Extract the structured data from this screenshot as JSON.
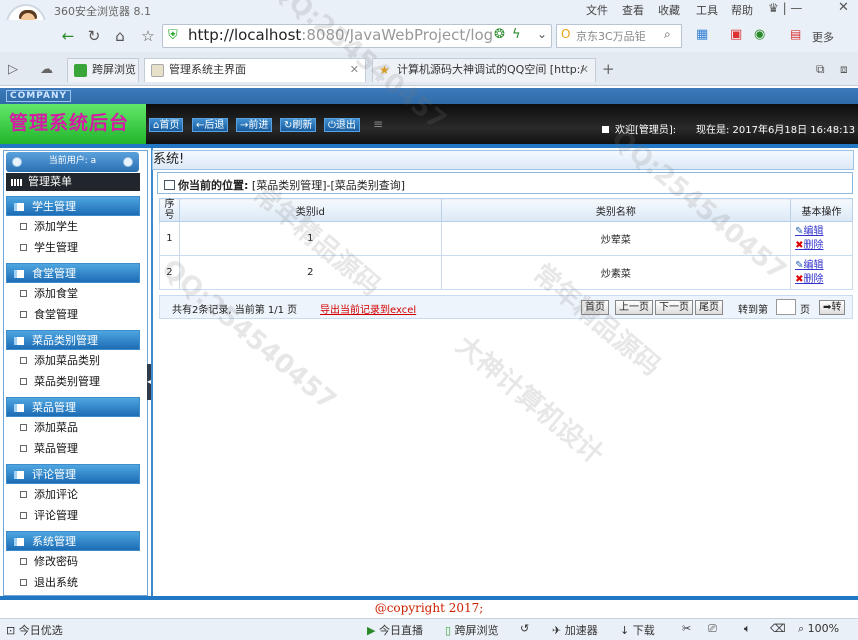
{
  "browser": {
    "name": "360安全浏览器 8.1",
    "menu": [
      "文件",
      "查看",
      "收藏",
      "工具",
      "帮助"
    ],
    "url_host": "http://localhost",
    "url_rest": ":8080/JavaWebProject/login/log",
    "search_placeholder": "京东3C万品钜",
    "more_label": "更多",
    "tabs": [
      {
        "label": "跨屏浏览"
      },
      {
        "label": "管理系统主界面"
      },
      {
        "label": "计算机源码大神调试的QQ空间 [http:/"
      }
    ],
    "status": {
      "left": "今日优选",
      "live": "今日直播",
      "cross": "跨屏浏览",
      "accel": "加速器",
      "download": "下载",
      "zoom": "100%"
    }
  },
  "app": {
    "company": "COMPANY",
    "logo": "管理系统后台",
    "toolbar": {
      "home": "首页",
      "back": "后退",
      "forward": "前进",
      "refresh": "刷新",
      "logout": "退出"
    },
    "welcome": "欢迎[管理员]:",
    "current_time": "现在是: 2017年6月18日 16:48:13",
    "current_user_label": "当前用户: a",
    "menu_title": "管理菜单",
    "menu_groups": [
      {
        "title": "学生管理",
        "items": [
          "添加学生",
          "学生管理"
        ]
      },
      {
        "title": "食堂管理",
        "items": [
          "添加食堂",
          "食堂管理"
        ]
      },
      {
        "title": "菜品类别管理",
        "items": [
          "添加菜品类别",
          "菜品类别管理"
        ]
      },
      {
        "title": "菜品管理",
        "items": [
          "添加菜品",
          "菜品管理"
        ]
      },
      {
        "title": "评论管理",
        "items": [
          "添加评论",
          "评论管理"
        ]
      },
      {
        "title": "系统管理",
        "items": [
          "修改密码",
          "退出系统"
        ]
      }
    ],
    "marquee": "系统!",
    "breadcrumb_label": "你当前的位置:",
    "breadcrumb": "[菜品类别管理]-[菜品类别查询]",
    "table": {
      "headers": [
        "序号",
        "类别id",
        "类别名称",
        "基本操作"
      ],
      "rows": [
        {
          "no": "1",
          "id": "1",
          "name": "炒荤菜"
        },
        {
          "no": "2",
          "id": "2",
          "name": "炒素菜"
        }
      ],
      "edit_label": "编辑",
      "delete_label": "删除"
    },
    "pager": {
      "info": "共有2条记录, 当前第 1/1 页",
      "export": "导出当前记录到excel",
      "first": "首页",
      "prev": "上一页",
      "next": "下一页",
      "last": "尾页",
      "jump_label": "转到第",
      "jump_unit": "页",
      "go": "转"
    },
    "copyright": "@copyright 2017;"
  },
  "watermark": [
    "QQ:254540457",
    "大神计算机设计",
    "常年精品源码"
  ]
}
